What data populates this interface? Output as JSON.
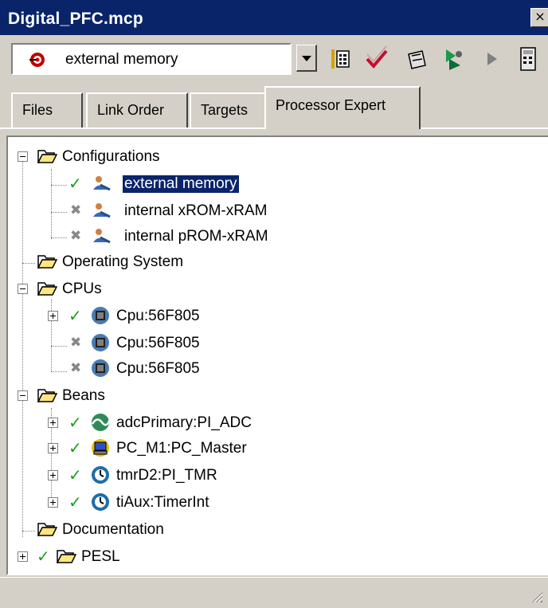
{
  "window": {
    "title": "Digital_PFC.mcp",
    "close_glyph": "×"
  },
  "toolbar": {
    "target_combo_value": "external memory",
    "target_icon": "target-bullseye-icon",
    "buttons": [
      "settings-icon",
      "check-make-icon",
      "debug-bug-icon",
      "run-icon",
      "step-icon",
      "calculator-icon"
    ]
  },
  "tabs": [
    {
      "label": "Files"
    },
    {
      "label": "Link Order"
    },
    {
      "label": "Targets"
    },
    {
      "label": "Processor Expert",
      "active": true
    }
  ],
  "tree": {
    "configurations": {
      "label": "Configurations",
      "items": [
        {
          "label": "external memory",
          "status": "check",
          "selected": true
        },
        {
          "label": "internal xROM-xRAM",
          "status": "x"
        },
        {
          "label": "internal pROM-xRAM",
          "status": "x"
        }
      ]
    },
    "operating_system": {
      "label": "Operating System"
    },
    "cpus": {
      "label": "CPUs",
      "items": [
        {
          "label": "Cpu:56F805",
          "status": "check",
          "expandable": true
        },
        {
          "label": "Cpu:56F805",
          "status": "x"
        },
        {
          "label": "Cpu:56F805",
          "status": "x"
        }
      ]
    },
    "beans": {
      "label": "Beans",
      "items": [
        {
          "label": "adcPrimary:PI_ADC",
          "status": "check",
          "icon": "adc-globe-icon"
        },
        {
          "label": "PC_M1:PC_Master",
          "status": "check",
          "icon": "pc-monitor-icon"
        },
        {
          "label": "tmrD2:PI_TMR",
          "status": "check",
          "icon": "timer-globe-icon"
        },
        {
          "label": "tiAux:TimerInt",
          "status": "check",
          "icon": "timer-globe-icon"
        }
      ]
    },
    "documentation": {
      "label": "Documentation"
    },
    "pesl": {
      "label": "PESL",
      "status": "check"
    }
  },
  "colors": {
    "selection": "#0a246a",
    "check": "#1b9e1b",
    "face": "#d4d0c8"
  }
}
